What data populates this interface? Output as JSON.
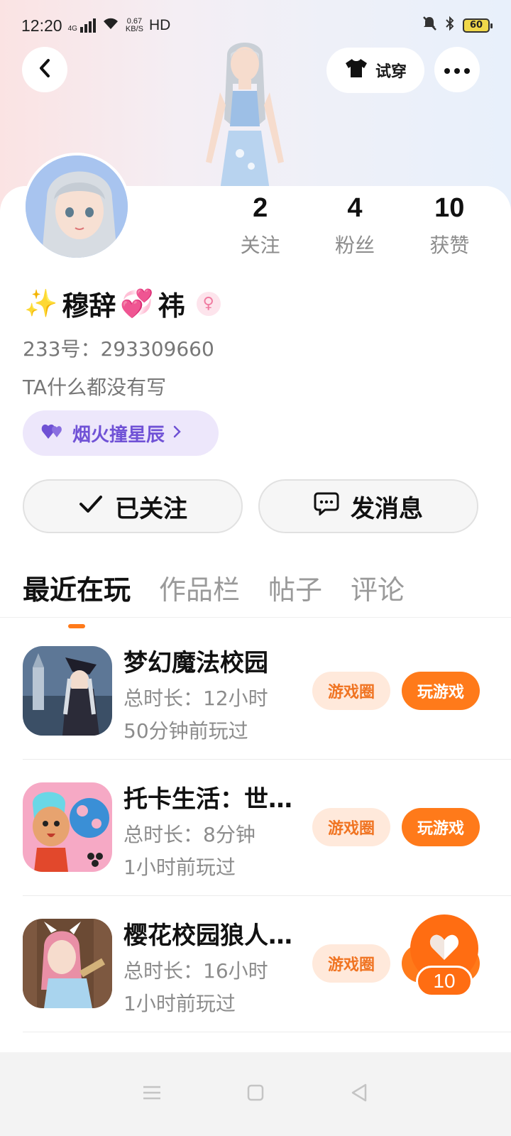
{
  "status_bar": {
    "time": "12:20",
    "network": "4G",
    "speed_value": "0.67",
    "speed_unit": "KB/S",
    "hd": "HD",
    "battery": "60"
  },
  "header": {
    "try_on_label": "试穿"
  },
  "stats": [
    {
      "value": "2",
      "label": "关注"
    },
    {
      "value": "4",
      "label": "粉丝"
    },
    {
      "value": "10",
      "label": "获赞"
    }
  ],
  "profile": {
    "name_prefix_emoji": "✨",
    "name_part1": "穆辞",
    "name_emoji": "💞",
    "name_part2": "祎",
    "gender_symbol": "♀",
    "uid": "233号：293309660",
    "bio": "TA什么都没有写",
    "tag_label": "烟火撞星辰"
  },
  "actions": {
    "followed_label": "已关注",
    "message_label": "发消息"
  },
  "tabs": [
    {
      "label": "最近在玩",
      "active": true
    },
    {
      "label": "作品栏",
      "active": false
    },
    {
      "label": "帖子",
      "active": false
    },
    {
      "label": "评论",
      "active": false
    }
  ],
  "games": [
    {
      "title": "梦幻魔法校园",
      "duration": "总时长：12小时",
      "last_played": "50分钟前玩过",
      "circle_label": "游戏圈",
      "play_label": "玩游戏"
    },
    {
      "title": "托卡生活：世…",
      "duration": "总时长：8分钟",
      "last_played": "1小时前玩过",
      "circle_label": "游戏圈",
      "play_label": "玩游戏"
    },
    {
      "title": "樱花校园狼人…",
      "duration": "总时长：16小时",
      "last_played": "1小时前玩过",
      "circle_label": "游戏圈",
      "play_label": "玩游戏"
    }
  ],
  "like_fab": {
    "count": "10"
  },
  "colors": {
    "accent": "#ff7a1a",
    "tag_text": "#7052d6",
    "tag_bg": "#ede7fb"
  }
}
